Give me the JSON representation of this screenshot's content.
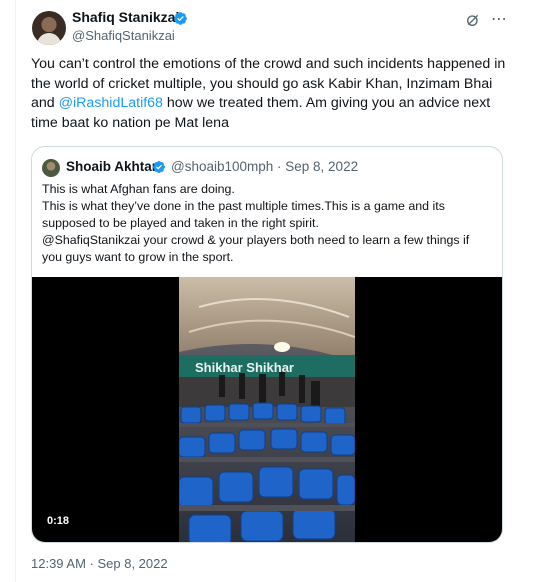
{
  "author": {
    "name": "Shafiq Stanikzai",
    "handle": "@ShafiqStanikzai"
  },
  "tweet": {
    "text_before": "You can’t control the emotions of the crowd and such incidents happened in the world of cricket multiple, you should go ask Kabir Khan, Inzimam Bhai and ",
    "mention": "@iRashidLatif68",
    "text_after": " how we treated them. Am giving you an advice next time baat ko nation pe Mat lena",
    "timestamp": "12:39 AM · Sep 8, 2022"
  },
  "quote": {
    "name": "Shoaib Akhtar",
    "meta": "@shoaib100mph · Sep 8, 2022",
    "lines": [
      "This is what Afghan fans are doing.",
      "This is what they’ve done in the past multiple times.This is a game and its supposed to be played and taken in the right spirit.",
      "@ShafiqStanikzai your crowd & your players both need to learn a few things if you guys want to grow in the sport."
    ],
    "video": {
      "duration": "0:18",
      "banner_text": "Shikhar Shikhar"
    }
  },
  "colors": {
    "accent": "#1d9bf0",
    "secondary_text": "#536471",
    "border": "#cfd9de"
  },
  "icons": {
    "verified": "verified-badge-icon",
    "grok": "grok-icon",
    "more": "more-options-icon"
  }
}
